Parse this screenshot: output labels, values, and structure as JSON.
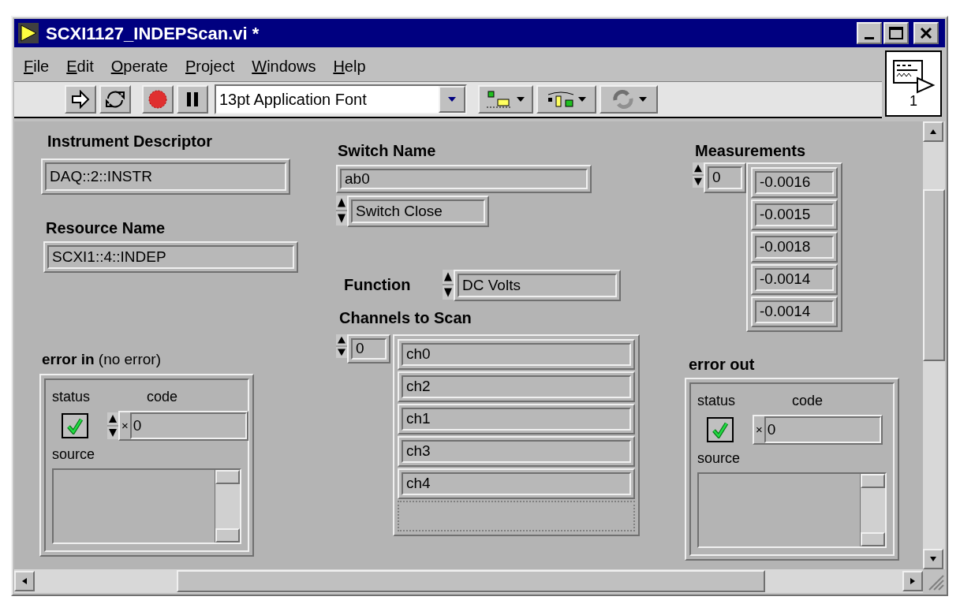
{
  "window": {
    "title": "SCXI1127_INDEPScan.vi *"
  },
  "menu": [
    {
      "label": "File"
    },
    {
      "label": "Edit"
    },
    {
      "label": "Operate"
    },
    {
      "label": "Project"
    },
    {
      "label": "Windows"
    },
    {
      "label": "Help"
    }
  ],
  "toolbar": {
    "font_ring": "13pt Application Font"
  },
  "connector_pane": {
    "label": "1"
  },
  "instrument_descriptor": {
    "label": "Instrument Descriptor",
    "value": "DAQ::2::INSTR"
  },
  "resource_name": {
    "label": "Resource Name",
    "value": "SCXI1::4::INDEP"
  },
  "switch_name": {
    "label": "Switch Name",
    "value": "ab0"
  },
  "switch_action": {
    "value": "Switch Close"
  },
  "function": {
    "label": "Function",
    "value": "DC Volts"
  },
  "channels": {
    "label": "Channels to Scan",
    "index": "0",
    "items": [
      "ch0",
      "ch2",
      "ch1",
      "ch3",
      "ch4"
    ]
  },
  "measurements": {
    "label": "Measurements",
    "index": "0",
    "items": [
      "-0.0016",
      "-0.0015",
      "-0.0018",
      "-0.0014",
      "-0.0014"
    ]
  },
  "error_in": {
    "label": "**error in** (no error)",
    "status_label": "status",
    "code_label": "code",
    "status": true,
    "code_prefix": "×",
    "code": "0",
    "source_label": "source"
  },
  "error_out": {
    "label": "error out",
    "status_label": "status",
    "code_label": "code",
    "status": true,
    "code_prefix": "×",
    "code": "0",
    "source_label": "source"
  }
}
